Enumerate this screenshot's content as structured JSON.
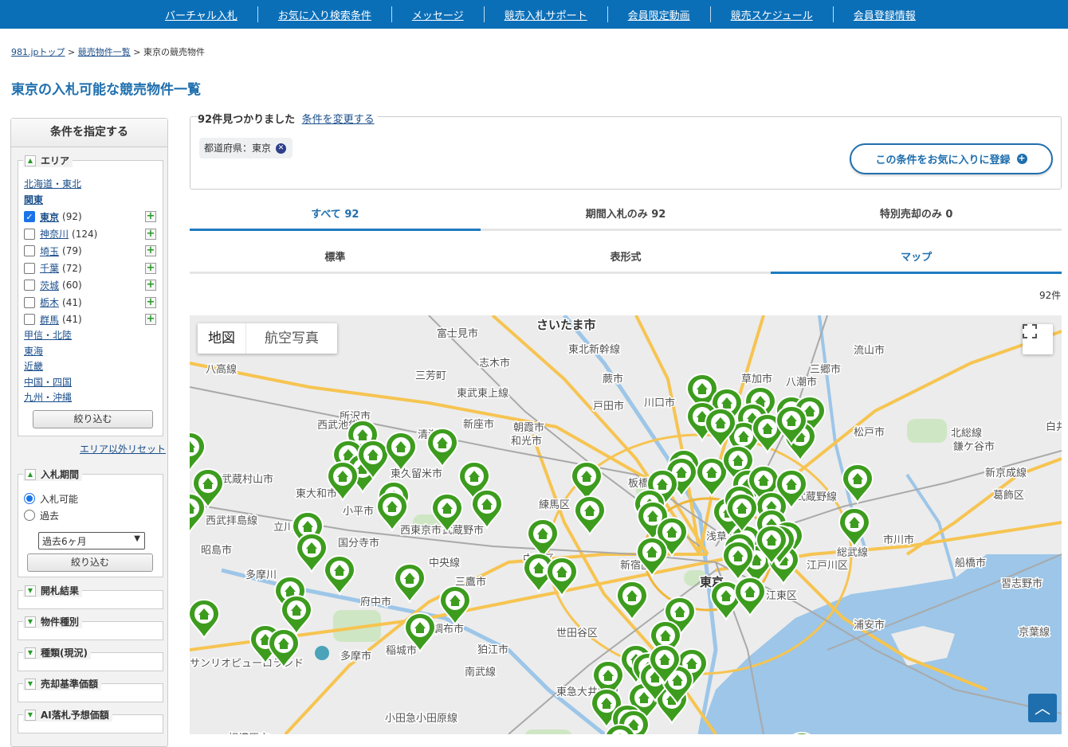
{
  "nav": [
    "バーチャル入札",
    "お気に入り検索条件",
    "メッセージ",
    "競売入札サポート",
    "会員限定動画",
    "競売スケジュール",
    "会員登録情報"
  ],
  "breadcrumb": {
    "home": "981.jpトップ",
    "list": "競売物件一覧",
    "current": "東京の競売物件",
    "sep": ">"
  },
  "page_title": "東京の入札可能な競売物件一覧",
  "sidebar": {
    "title": "条件を指定する",
    "area": {
      "label": "エリア",
      "regions_before": [
        "北海道・東北"
      ],
      "kanto": "関東",
      "prefs": [
        {
          "name": "東京",
          "count": "(92)",
          "checked": true
        },
        {
          "name": "神奈川",
          "count": "(124)",
          "checked": false
        },
        {
          "name": "埼玉",
          "count": "(79)",
          "checked": false
        },
        {
          "name": "千葉",
          "count": "(72)",
          "checked": false
        },
        {
          "name": "茨城",
          "count": "(60)",
          "checked": false
        },
        {
          "name": "栃木",
          "count": "(41)",
          "checked": false
        },
        {
          "name": "群馬",
          "count": "(41)",
          "checked": false
        }
      ],
      "regions_after": [
        "甲信・北陸",
        "東海",
        "近畿",
        "中国・四国",
        "九州・沖縄"
      ],
      "narrow_button": "絞り込む",
      "reset_link": "エリア以外リセット"
    },
    "period": {
      "label": "入札期間",
      "option_available": "入札可能",
      "option_past": "過去",
      "select_value": "過去6ヶ月",
      "narrow_button": "絞り込む"
    },
    "collapsed_sections": [
      "開札結果",
      "物件種別",
      "種類(現況)",
      "売却基準価額",
      "AI落札予想価額"
    ]
  },
  "results": {
    "found_text": "92件見つかりました",
    "change_link": "条件を変更する",
    "chip_label": "都道府県：東京",
    "fav_button": "この条件をお気に入りに登録",
    "count_label": "92件"
  },
  "tabs_sale": [
    {
      "label": "すべて 92",
      "active": true
    },
    {
      "label": "期間入札のみ 92",
      "active": false
    },
    {
      "label": "特別売却のみ 0",
      "active": false
    }
  ],
  "tabs_view": [
    {
      "label": "標準",
      "active": false
    },
    {
      "label": "表形式",
      "active": false
    },
    {
      "label": "マップ",
      "active": true
    }
  ],
  "map": {
    "type_map": "地図",
    "type_satellite": "航空写真",
    "marker_color": "#3d9c1e",
    "labels": [
      {
        "text": "さいたま市",
        "big": true
      },
      {
        "text": "富士見市"
      },
      {
        "text": "志木市"
      },
      {
        "text": "三芳町"
      },
      {
        "text": "蕨市"
      },
      {
        "text": "戸田市"
      },
      {
        "text": "川口市"
      },
      {
        "text": "草加市"
      },
      {
        "text": "八潮市"
      },
      {
        "text": "三郷市"
      },
      {
        "text": "流山市"
      },
      {
        "text": "松戸市"
      },
      {
        "text": "白井市"
      },
      {
        "text": "鎌ケ谷市"
      },
      {
        "text": "所沢市"
      },
      {
        "text": "清瀬市"
      },
      {
        "text": "新座市"
      },
      {
        "text": "朝霞市"
      },
      {
        "text": "和光市"
      },
      {
        "text": "武蔵村山市"
      },
      {
        "text": "東大和市"
      },
      {
        "text": "東久留米市"
      },
      {
        "text": "板橋区"
      },
      {
        "text": "練馬区"
      },
      {
        "text": "西東京市"
      },
      {
        "text": "武蔵野市"
      },
      {
        "text": "小平市"
      },
      {
        "text": "国分寺市"
      },
      {
        "text": "立川市"
      },
      {
        "text": "昭島市"
      },
      {
        "text": "三鷹市"
      },
      {
        "text": "府中市"
      },
      {
        "text": "調布市"
      },
      {
        "text": "狛江市"
      },
      {
        "text": "多摩市"
      },
      {
        "text": "稲城市"
      },
      {
        "text": "世田谷区"
      },
      {
        "text": "新宿区"
      },
      {
        "text": "中野区"
      },
      {
        "text": "浅草寺"
      },
      {
        "text": "東京",
        "big": true
      },
      {
        "text": "江東区"
      },
      {
        "text": "江戸川区"
      },
      {
        "text": "市川市"
      },
      {
        "text": "船橋市"
      },
      {
        "text": "習志野市"
      },
      {
        "text": "浦安市"
      },
      {
        "text": "葛飾区"
      },
      {
        "text": "相模原市"
      },
      {
        "text": "サンリオピューロランド"
      },
      {
        "text": "西武池袋線"
      },
      {
        "text": "東武東上線"
      },
      {
        "text": "東北新幹線"
      },
      {
        "text": "西武拝島線"
      },
      {
        "text": "中央線"
      },
      {
        "text": "多摩川"
      },
      {
        "text": "南武線"
      },
      {
        "text": "小田急小田原線"
      },
      {
        "text": "東急大井町線"
      },
      {
        "text": "武蔵野線"
      },
      {
        "text": "総武線"
      },
      {
        "text": "新京成線"
      },
      {
        "text": "北総線"
      },
      {
        "text": "京葉線"
      },
      {
        "text": "八高線"
      }
    ]
  },
  "page_top_icon": "chevron-up-icon"
}
